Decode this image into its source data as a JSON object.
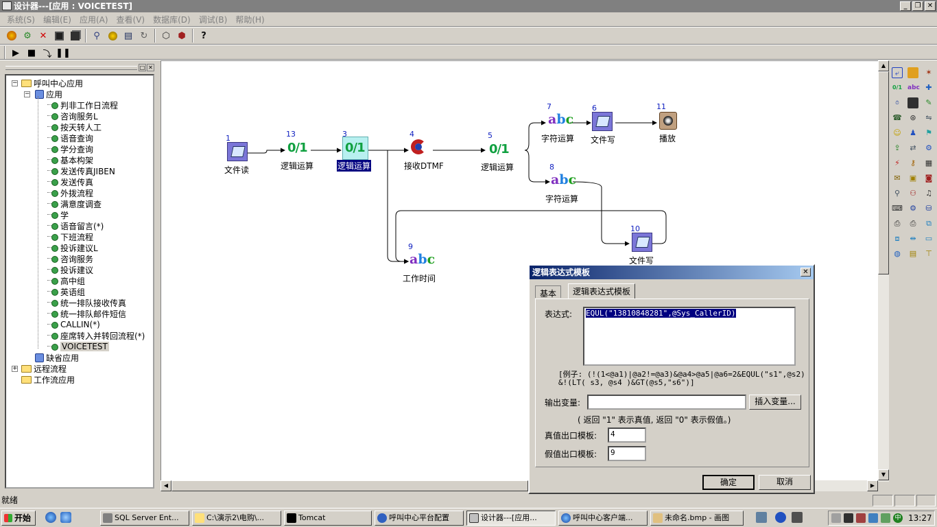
{
  "window": {
    "title": "设计器---[应用 : VOICETEST]"
  },
  "menu": [
    "系统(S)",
    "编辑(E)",
    "应用(A)",
    "查看(V)",
    "数据库(D)",
    "调试(B)",
    "帮助(H)"
  ],
  "toolbar1": [
    "open-icon",
    "settings-icon",
    "delete-icon",
    "save-icon",
    "save-all-icon",
    "find-icon",
    "compile-icon",
    "export-icon",
    "refresh-icon",
    "package-icon",
    "deploy-icon",
    "help-icon"
  ],
  "toolbar2": [
    "run-icon",
    "stop-icon",
    "step-icon",
    "pause-icon"
  ],
  "tree": {
    "root": "呼叫中心应用",
    "app_folder": "应用",
    "items": [
      "判非工作日流程",
      "咨询服务L",
      "按天转人工",
      "语音查询",
      "学分查询",
      "基本构架",
      "发送传真JIBEN",
      "发送传真",
      "外拨流程",
      "满意度调查",
      "学",
      "语音留言(*)",
      "下班流程",
      "投诉建议L",
      "咨询服务",
      "投诉建议",
      "高中组",
      "英语组",
      "统一排队接收传真",
      "统一排队邮件短信",
      "CALLIN(*)",
      "座席转入并转回流程(*)",
      "VOICETEST"
    ],
    "default_app": "缺省应用",
    "remote": "远程流程",
    "workflow": "工作流应用"
  },
  "flow": {
    "nodes": [
      {
        "id": "1",
        "label": "文件读",
        "kind": "file"
      },
      {
        "id": "13",
        "label": "逻辑运算",
        "kind": "logic"
      },
      {
        "id": "3",
        "label": "逻辑运算",
        "kind": "logic-selected"
      },
      {
        "id": "4",
        "label": "接收DTMF",
        "kind": "dtmf"
      },
      {
        "id": "5",
        "label": "逻辑运算",
        "kind": "logic"
      },
      {
        "id": "7",
        "label": "字符运算",
        "kind": "string"
      },
      {
        "id": "6",
        "label": "文件写",
        "kind": "file"
      },
      {
        "id": "11",
        "label": "播放",
        "kind": "play"
      },
      {
        "id": "8",
        "label": "字符运算",
        "kind": "string"
      },
      {
        "id": "10",
        "label": "文件写",
        "kind": "file"
      },
      {
        "id": "9",
        "label": "工作时间",
        "kind": "string"
      }
    ],
    "logic_text": "0/1",
    "string_text": "abc"
  },
  "dialog": {
    "title": "逻辑表达式模板",
    "tabs": [
      "基本",
      "逻辑表达式模板"
    ],
    "expr_label": "表达式:",
    "expr_value": "EQUL(\"13810848281\",@Sys_CallerID)",
    "example_line1": "[例子: (!(1<@a1)|@a2!=@a3)&@a4>@a5|@a6=2&EQUL(\"s1\",@s2)",
    "example_line2": "&!(LT( s3, @s4 )&GT(@s5,\"s6\")]",
    "output_label": "输出变量:",
    "output_value": "",
    "insert_btn": "插入变量...",
    "hint": "( 返回 \"1\" 表示真值, 返回 \"0\" 表示假值。)",
    "true_label": "真值出口模板:",
    "true_value": "4",
    "false_label": "假值出口模板:",
    "false_value": "9",
    "ok": "确定",
    "cancel": "取消"
  },
  "status": {
    "text": "就绪"
  },
  "taskbar": {
    "start": "开始",
    "tasks": [
      "SQL Server Ent...",
      "C:\\演示2\\电购\\...",
      "Tomcat",
      "呼叫中心平台配置",
      "设计器---[应用...",
      "呼叫中心客户端...",
      "未命名.bmp - 画图"
    ],
    "clock": "13:27"
  }
}
